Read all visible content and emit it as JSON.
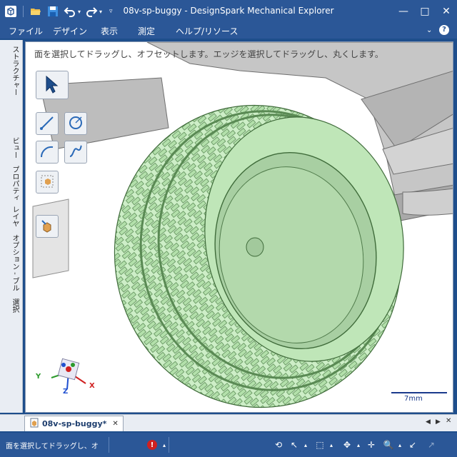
{
  "window": {
    "title": "08v-sp-buggy - DesignSpark Mechanical Explorer",
    "minimize_glyph": "—",
    "maximize_glyph": "□",
    "close_glyph": "✕"
  },
  "menu": {
    "items": [
      "ファイル",
      "デザイン",
      "表示",
      "測定",
      "ヘルプ/リソース"
    ],
    "help_glyph": "?",
    "collapse_glyph": "⌄"
  },
  "left_tabs": [
    "ストラクチャー",
    "ビュー",
    "プロパティ",
    "レイヤ",
    "オプション - ブル",
    "選択"
  ],
  "viewport": {
    "hint": "面を選択してドラッグし、オフセットします。エッジを選択してドラッグし、丸くします。",
    "axis_labels": {
      "x": "X",
      "y": "Y",
      "z": "Z"
    },
    "scale_label": "7mm"
  },
  "document_tab": {
    "label": "08v-sp-buggy*",
    "close_glyph": "✕"
  },
  "status": {
    "text": "面を選択してドラッグし、オ",
    "error_glyph": "!"
  },
  "colors": {
    "chrome": "#2b5797",
    "tire_green": "#b7e8b0",
    "rim_green": "#a8cfa2",
    "body_gray": "#bcbcbc"
  },
  "icons": {
    "app": "app-cube-icon",
    "open": "folder-open-icon",
    "save": "save-icon",
    "undo": "undo-icon",
    "redo": "redo-icon"
  }
}
